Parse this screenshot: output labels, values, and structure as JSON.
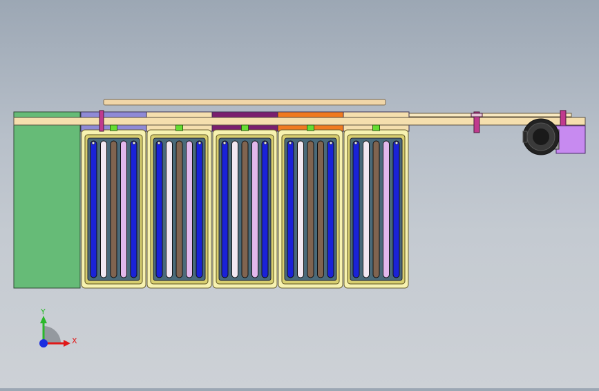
{
  "viewport": {
    "background_top": "#9ca7b4",
    "background_bottom": "#cdd1d6"
  },
  "triad": {
    "x_label": "X",
    "y_label": "Y",
    "x_color": "#e01818",
    "y_color": "#2ab82a",
    "z_color": "#1a2ee0"
  },
  "model": {
    "left_block_color": "#66bb77",
    "bar_color": "#f5dfae",
    "frame_color": "#f7f2b0",
    "modules": [
      {
        "header_color": "#8f8ad6",
        "pin_color": "#66dd33",
        "slats": [
          "#1a22d8",
          "#f2e8f2",
          "#806450",
          "#e2b8ec",
          "#1a22d8"
        ]
      },
      {
        "header_color": "#f5dfae",
        "pin_color": "#66dd33",
        "slats": [
          "#1a22d8",
          "#f2e8f2",
          "#806450",
          "#e2b8ec",
          "#1a22d8"
        ]
      },
      {
        "header_color": "#7a1f6e",
        "pin_color": "#66dd33",
        "slats": [
          "#1a22d8",
          "#f2e8f2",
          "#806450",
          "#e2b8ec",
          "#1a22d8"
        ]
      },
      {
        "header_color": "#f07a20",
        "pin_color": "#66dd33",
        "slats": [
          "#1a22d8",
          "#f2e8f2",
          "#806450",
          "#806450",
          "#1a22d8"
        ]
      },
      {
        "header_color": "#f5dfae",
        "pin_color": "#66dd33",
        "slats": [
          "#1a22d8",
          "#f2e8f2",
          "#806450",
          "#e2b8ec",
          "#1a22d8"
        ]
      }
    ],
    "motor_color": "#222222",
    "motor_mount_color": "#c78af0"
  }
}
